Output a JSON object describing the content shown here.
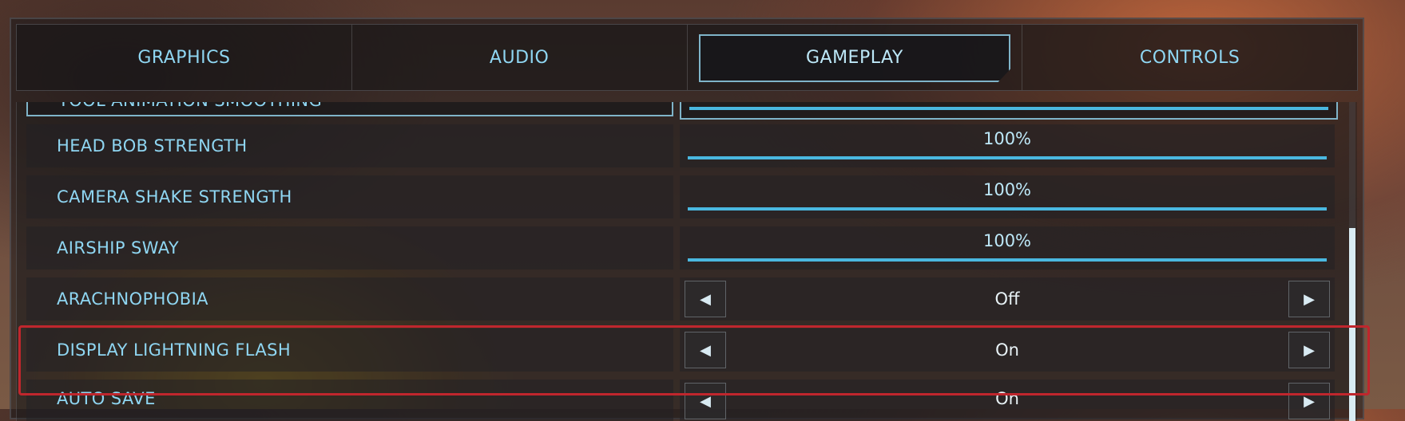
{
  "tabs": [
    {
      "label": "GRAPHICS",
      "active": false
    },
    {
      "label": "AUDIO",
      "active": false
    },
    {
      "label": "GAMEPLAY",
      "active": true
    },
    {
      "label": "CONTROLS",
      "active": false
    }
  ],
  "settings": {
    "partial_top": {
      "label": "TOOL ANIMATION SMOOTHING",
      "level": 1.0
    },
    "head_bob": {
      "label": "HEAD BOB STRENGTH",
      "value": "100%",
      "level": 1.0
    },
    "camera_shake": {
      "label": "CAMERA SHAKE STRENGTH",
      "value": "100%",
      "level": 1.0
    },
    "airship_sway": {
      "label": "AIRSHIP SWAY",
      "value": "100%",
      "level": 1.0
    },
    "arachnophobia": {
      "label": "ARACHNOPHOBIA",
      "value": "Off"
    },
    "lightning_flash": {
      "label": "DISPLAY LIGHTNING FLASH",
      "value": "On"
    },
    "auto_save": {
      "label": "AUTO SAVE",
      "value": "On"
    }
  },
  "icons": {
    "prev": "◀",
    "next": "▶"
  },
  "colors": {
    "accent": "#8fd6f2",
    "slider_fill": "#4ab8e0",
    "highlight": "#c0262d"
  }
}
